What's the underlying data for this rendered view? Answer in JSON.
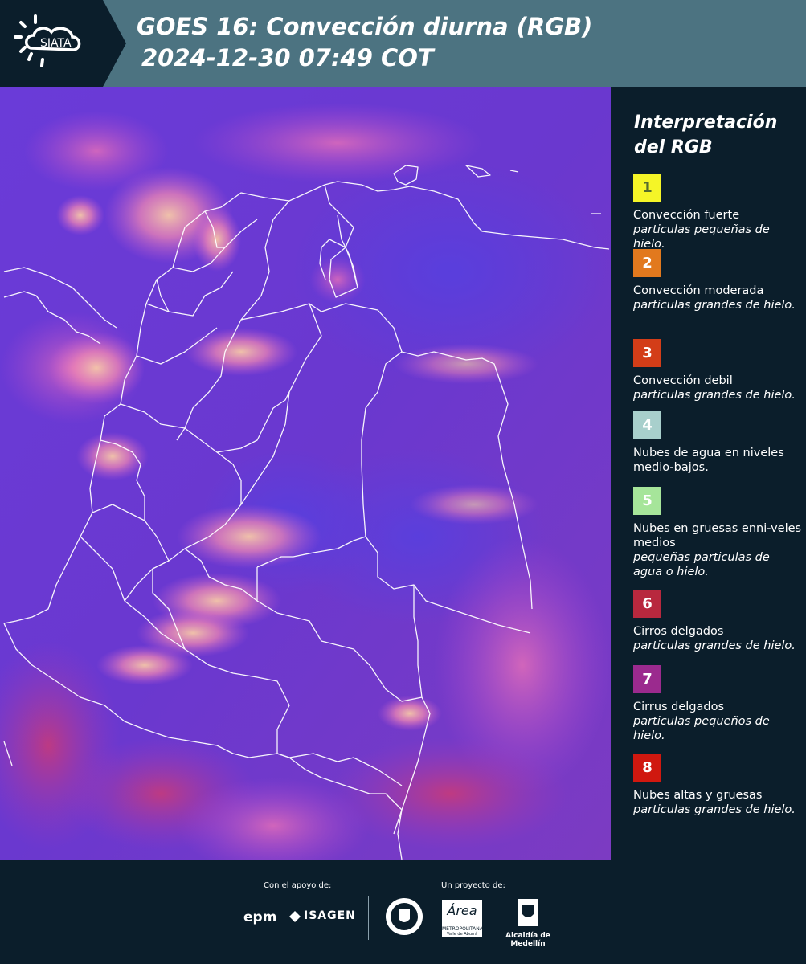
{
  "header": {
    "logo_text": "SIATA",
    "title_line1": "GOES 16: Convección diurna (RGB)",
    "title_line2": "2024-12-30 07:49 COT",
    "bar_color": "#4c7381",
    "logo_color": "#0b1e2b"
  },
  "legend": {
    "title_line1": "Interpretación",
    "title_line2": "del RGB",
    "items": [
      {
        "number": "1",
        "color": "#f5f527",
        "number_color": "#556b2f",
        "name": "Convección fuerte",
        "desc": "particulas pequeñas de hielo."
      },
      {
        "number": "2",
        "color": "#e2791e",
        "number_color": "#ffffff",
        "name": "Convección moderada",
        "desc": "particulas grandes de hielo."
      },
      {
        "number": "3",
        "color": "#d33d18",
        "number_color": "#ffffff",
        "name": "Convección debil",
        "desc": "particulas grandes de hielo."
      },
      {
        "number": "4",
        "color": "#a8cfcc",
        "number_color": "#ffffff",
        "name": "Nubes de agua en niveles medio-bajos.",
        "desc": ""
      },
      {
        "number": "5",
        "color": "#a6e59a",
        "number_color": "#ffffff",
        "name": "Nubes en gruesas enni-veles medios",
        "desc": "pequeñas particulas de agua o hielo."
      },
      {
        "number": "6",
        "color": "#b8283e",
        "number_color": "#ffffff",
        "name": "Cirros delgados",
        "desc": "particulas grandes de hielo."
      },
      {
        "number": "7",
        "color": "#9b2a8e",
        "number_color": "#ffffff",
        "name": "Cirrus delgados",
        "desc": "particulas pequeños de hielo."
      },
      {
        "number": "8",
        "color": "#d0180f",
        "number_color": "#ffffff",
        "name": "Nubes altas y gruesas",
        "desc": "particulas grandes de hielo."
      }
    ]
  },
  "footer": {
    "support_label": "Con el apoyo de:",
    "project_label": "Un proyecto de:",
    "support_partners": [
      "epm",
      "ISAGEN"
    ],
    "project_partners": [
      "METROPOLITANA Valle de Aburrá",
      "Alcaldía de Medellín"
    ],
    "area_logo_text": "Área",
    "area_logo_sub1": "METROPOLITANA",
    "area_logo_sub2": "Valle de Aburrá"
  }
}
